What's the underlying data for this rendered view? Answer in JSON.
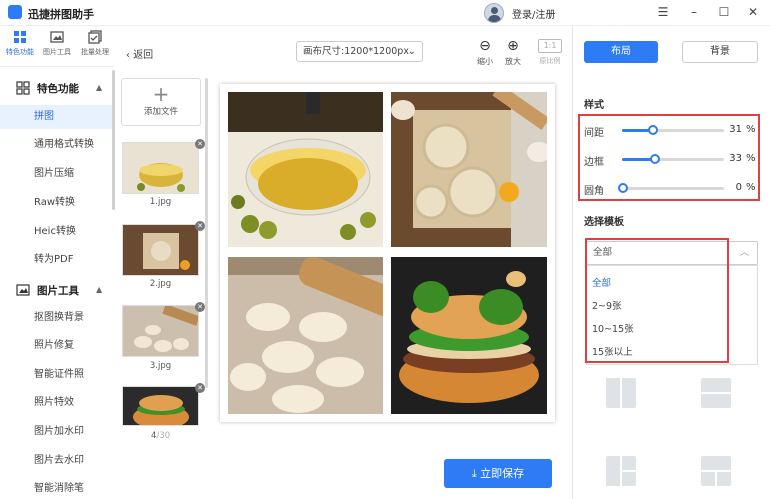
{
  "app": {
    "title": "迅捷拼图助手",
    "login": "登录/注册"
  },
  "window": {
    "minimize": "–",
    "maximize": "☐",
    "close": "✕",
    "menu": "☰"
  },
  "toolbar": {
    "items": [
      {
        "label": "特色功能",
        "icon": "grid-icon",
        "active": true
      },
      {
        "label": "图片工具",
        "icon": "image-tool-icon"
      },
      {
        "label": "批量处理",
        "icon": "batch-icon"
      }
    ]
  },
  "sidebar": {
    "sections": [
      {
        "title": "特色功能",
        "items": [
          "拼图",
          "通用格式转换",
          "图片压缩",
          "Raw转换",
          "Heic转换",
          "转为PDF"
        ]
      },
      {
        "title": "图片工具",
        "items": [
          "抠图换背景",
          "照片修复",
          "智能证件照",
          "照片特效",
          "图片加水印",
          "图片去水印",
          "智能消除笔"
        ]
      }
    ],
    "active": "拼图"
  },
  "editor": {
    "back": "返回",
    "canvas_size": "画布尺寸:1200*1200px",
    "zoom_out": "缩小",
    "zoom_in": "放大",
    "ratio_box": "1:1",
    "ratio_label": "原比例",
    "save": "立即保存"
  },
  "files": {
    "add_label": "添加文件",
    "items": [
      "1.jpg",
      "2.jpg",
      "3.jpg"
    ],
    "counter_current": "4",
    "counter_total": "/30"
  },
  "right_panel": {
    "tabs": {
      "layout": "布局",
      "background": "背景"
    },
    "style_title": "样式",
    "sliders": [
      {
        "label": "间距",
        "value": 31,
        "unit": "%"
      },
      {
        "label": "边框",
        "value": 33,
        "unit": "%"
      },
      {
        "label": "圆角",
        "value": 0,
        "unit": "%"
      }
    ],
    "template_title": "选择模板",
    "template_selected": "全部",
    "template_options": [
      "全部",
      "2~9张",
      "10~15张",
      "15张以上"
    ]
  },
  "colors": {
    "accent": "#2d7cf6",
    "highlight": "#e04040"
  }
}
